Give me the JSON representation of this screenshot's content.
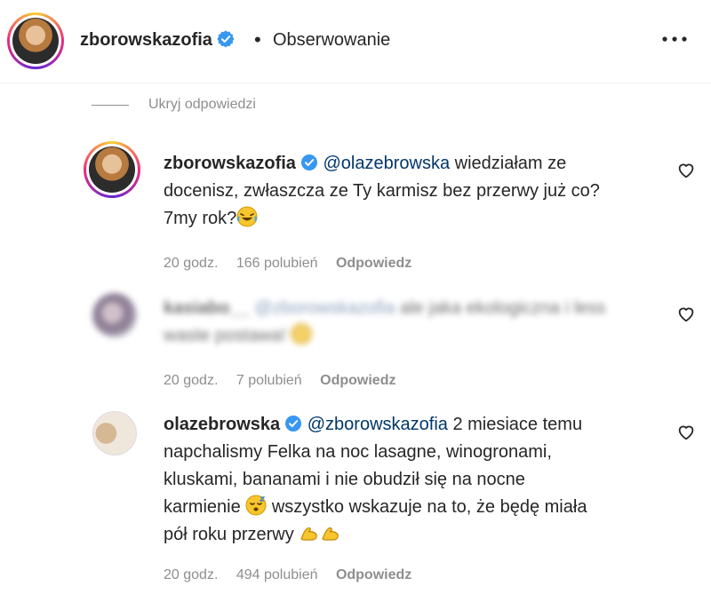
{
  "header": {
    "username": "zborowskazofia",
    "separator": "•",
    "follow_label": "Obserwowanie"
  },
  "hide_replies": "Ukryj odpowiedzi",
  "comments": [
    {
      "username": "zborowskazofia",
      "mention": "@olazebrowska",
      "text_lines": [
        "wiedziałam ze",
        "docenisz, zwłaszcza ze Ty karmisz bez przerwy już co?",
        "7my rok?"
      ],
      "time": "20 godz.",
      "likes": "166 polubień",
      "reply": "Odpowiedz"
    },
    {
      "username": "kasiabo__",
      "mention": "@zborowskazofia",
      "text_lines": [
        "ale jaka ekologiczna i less",
        "waste postawa!"
      ],
      "time": "20 godz.",
      "likes": "7 polubień",
      "reply": "Odpowiedz"
    },
    {
      "username": "olazebrowska",
      "mention": "@zborowskazofia",
      "text_lines": [
        "2 miesiace temu",
        "napchalismy Felka na noc lasagne, winogronami,",
        "kluskami, bananami i nie obudził się na nocne",
        "karmienie",
        "wszystko wskazuje na to, że będę miała",
        "pół roku przerwy"
      ],
      "time": "20 godz.",
      "likes": "494 polubień",
      "reply": "Odpowiedz"
    }
  ],
  "colors": {
    "verified": "#3897f0",
    "text": "#262626",
    "muted": "#8e8e8e",
    "mention": "#00376b"
  },
  "icons": [
    "verified-badge-icon",
    "more-options-icon",
    "heart-icon",
    "laughing-emoji",
    "sleepy-emoji",
    "flexed-biceps-emoji"
  ]
}
